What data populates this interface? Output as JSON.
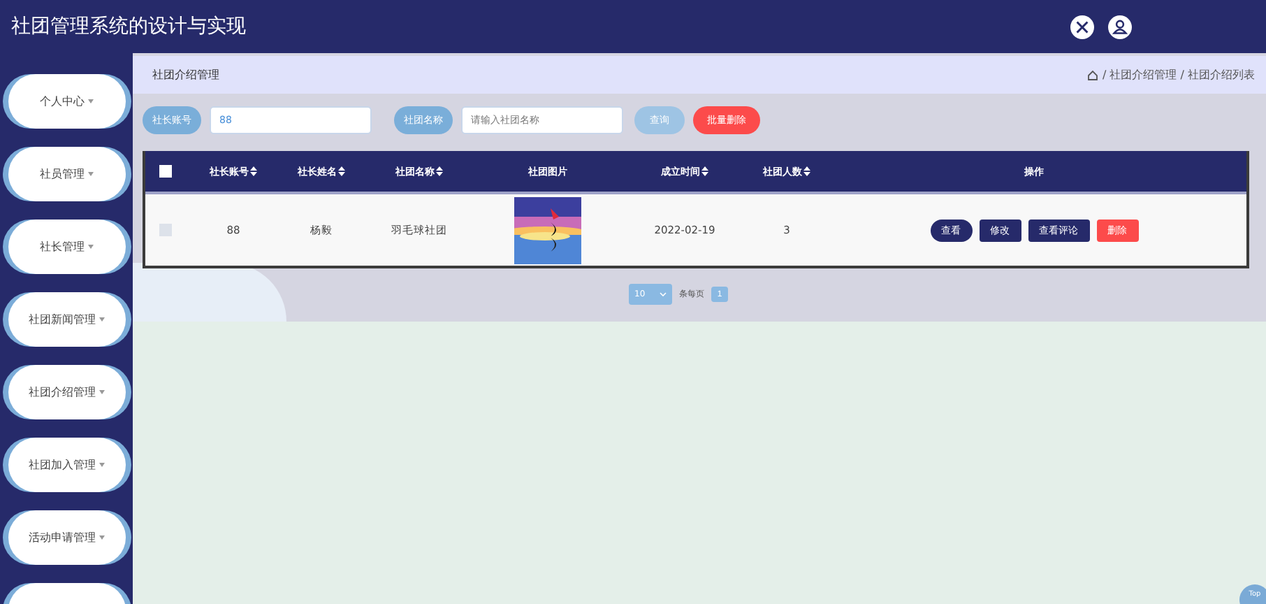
{
  "header": {
    "title": "社团管理系统的设计与实现"
  },
  "sidebar": {
    "items": [
      {
        "label": "个人中心"
      },
      {
        "label": "社员管理"
      },
      {
        "label": "社长管理"
      },
      {
        "label": "社团新闻管理"
      },
      {
        "label": "社团介绍管理"
      },
      {
        "label": "社团加入管理"
      },
      {
        "label": "活动申请管理"
      }
    ]
  },
  "breadcrumb": {
    "title": "社团介绍管理",
    "trail": "/ 社团介绍管理 / 社团介绍列表"
  },
  "search": {
    "fields": [
      {
        "label": "社长账号",
        "value": "88"
      },
      {
        "label": "社团名称",
        "placeholder": "请输入社团名称"
      }
    ],
    "buttons": [
      {
        "label": "查询",
        "kind": "primary"
      },
      {
        "label": "批量删除",
        "kind": "danger"
      }
    ]
  },
  "table": {
    "select_all": {
      "checked": false
    },
    "columns": [
      {
        "label": "社长账号",
        "sortable": true
      },
      {
        "label": "社长姓名",
        "sortable": true
      },
      {
        "label": "社团名称",
        "sortable": true
      },
      {
        "label": "社团图片",
        "sortable": false
      },
      {
        "label": "成立时间",
        "sortable": true
      },
      {
        "label": "社团人数",
        "sortable": true
      },
      {
        "label": "操作",
        "sortable": false
      }
    ],
    "rows": [
      {
        "checked": false,
        "cells": [
          {
            "kind": "text",
            "text": "88"
          },
          {
            "kind": "text",
            "text": "杨毅"
          },
          {
            "kind": "text",
            "text": "羽毛球社团"
          },
          {
            "kind": "picture"
          },
          {
            "kind": "text",
            "text": "2022-02-19"
          },
          {
            "kind": "text",
            "text": "3"
          }
        ],
        "actions": [
          {
            "label": "查看",
            "kind": "pill"
          },
          {
            "label": "修改",
            "kind": "dark"
          },
          {
            "label": "查看评论",
            "kind": "dark"
          },
          {
            "label": "删除",
            "kind": "danger"
          }
        ]
      }
    ]
  },
  "pagination": {
    "page_size": "10",
    "page_size_label": "条每页",
    "pages": [
      {
        "label": "1",
        "selected": true
      }
    ]
  },
  "top_button": {
    "label": "Top"
  }
}
